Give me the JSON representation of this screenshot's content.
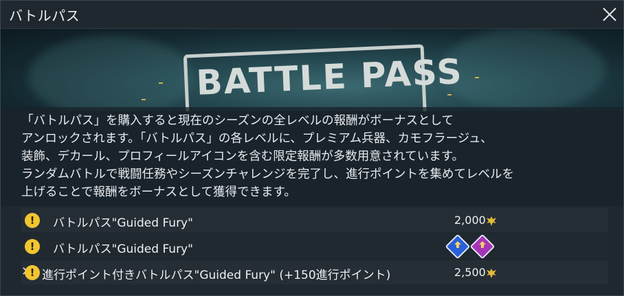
{
  "window": {
    "title": "バトルパス"
  },
  "banner": {
    "logo_text": "BATTLE PASS"
  },
  "description": "「バトルパス」を購入すると現在のシーズンの全レベルの報酬がボーナスとして\nアンロックされます。「バトルパス」の各レベルに、プレミアム兵器、カモフラージュ、\n装飾、デカール、プロフィールアイコンを含む限定報酬が多数用意されています。\nランダムバトルで戦闘任務やシーズンチャレンジを完了し、進行ポイントを集めてレベルを\n上げることで報酬をボーナスとして獲得できます。",
  "items": [
    {
      "name": "バトルパス\"Guided Fury\"",
      "price": "2,000",
      "currency_icon": "gold-eagle-icon",
      "status_icon": "warning-icon"
    },
    {
      "name": "バトルパス\"Guided Fury\"",
      "price": "",
      "coupon_icons": [
        "blue-coupon-icon",
        "purple-coupon-icon"
      ],
      "status_icon": "warning-icon"
    },
    {
      "name": "進行ポイント付きバトルパス\"Guided Fury\" (+150進行ポイント)",
      "price": "2,500",
      "currency_icon": "gold-eagle-icon",
      "status_icon": "warning-icon"
    }
  ],
  "colors": {
    "warning": "#f2c531",
    "gold": "#e3b93a",
    "coupon_blue": "#2b5fd6",
    "coupon_purple": "#a634b8"
  }
}
